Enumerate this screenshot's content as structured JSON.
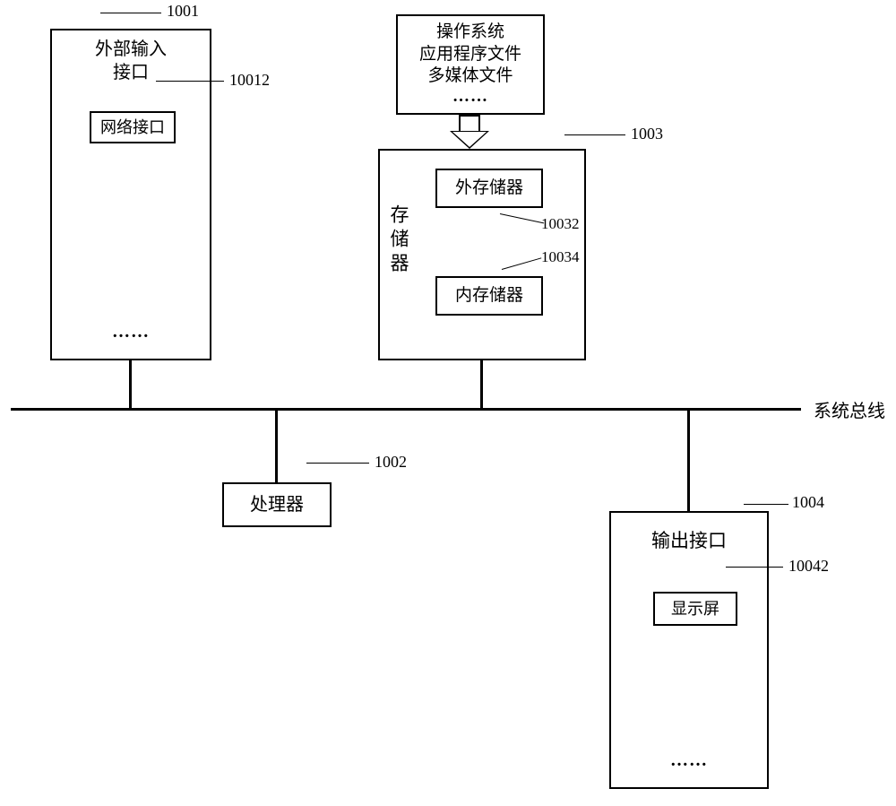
{
  "bus_label": "系统总线",
  "blocks": {
    "ext_input": {
      "ref": "1001",
      "title_l1": "外部输入",
      "title_l2": "接口",
      "net_if": {
        "ref": "10012",
        "label": "网络接口"
      },
      "dots": "……"
    },
    "file_source": {
      "line1": "操作系统",
      "line2": "应用程序文件",
      "line3": "多媒体文件",
      "dots": "……"
    },
    "memory": {
      "ref": "1003",
      "title": "存储器",
      "ext_mem": {
        "ref": "10032",
        "label": "外存储器"
      },
      "int_mem": {
        "ref": "10034",
        "label": "内存储器"
      }
    },
    "cpu": {
      "ref": "1002",
      "label": "处理器"
    },
    "output": {
      "ref": "1004",
      "title": "输出接口",
      "display": {
        "ref": "10042",
        "label": "显示屏"
      },
      "dots": "……"
    }
  }
}
